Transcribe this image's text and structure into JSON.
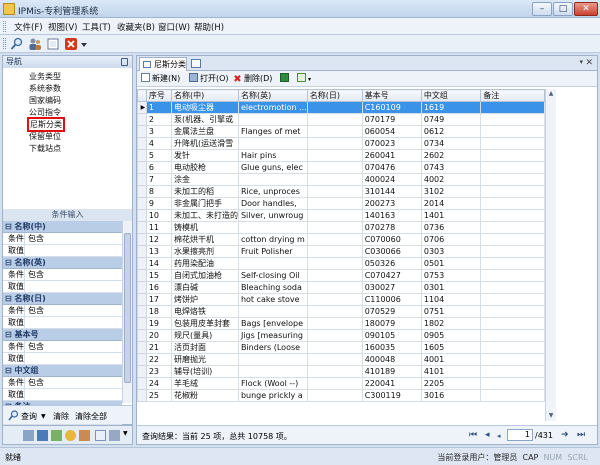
{
  "window": {
    "title": "IPMis-专利管理系统",
    "min": "–",
    "max": "□",
    "close": "✕"
  },
  "menu": [
    "文件(F)",
    "视图(V)",
    "工具(T)",
    "收藏夹(B)",
    "窗口(W)",
    "帮助(H)"
  ],
  "toolbar_icons": [
    "search-icon",
    "users-icon",
    "add-icon",
    "delete-icon",
    "dropdown-icon"
  ],
  "nav": {
    "title": "导航",
    "items": [
      "业务类型",
      "系统参数",
      "国家编码",
      "公司指令",
      "尼斯分类",
      "保留单位",
      "下载站点"
    ],
    "selected": "尼斯分类"
  },
  "conditions": {
    "title": "条件输入",
    "groups": [
      {
        "name": "名称(中)",
        "rows": [
          {
            "k": "条件",
            "v": "包含"
          },
          {
            "k": "取值",
            "v": ""
          }
        ]
      },
      {
        "name": "名称(英)",
        "rows": [
          {
            "k": "条件",
            "v": "包含"
          },
          {
            "k": "取值",
            "v": ""
          }
        ]
      },
      {
        "name": "名称(日)",
        "rows": [
          {
            "k": "条件",
            "v": "包含"
          },
          {
            "k": "取值",
            "v": ""
          }
        ]
      },
      {
        "name": "基本号",
        "rows": [
          {
            "k": "条件",
            "v": "包含"
          },
          {
            "k": "取值",
            "v": ""
          }
        ]
      },
      {
        "name": "中文组",
        "rows": [
          {
            "k": "条件",
            "v": "包含"
          },
          {
            "k": "取值",
            "v": ""
          }
        ]
      },
      {
        "name": "备注",
        "rows": [
          {
            "k": "条件",
            "v": "包含"
          },
          {
            "k": "取值",
            "v": ""
          }
        ]
      }
    ],
    "query_label": "查询",
    "clear_label": "清除",
    "clear_all_label": "清除全部"
  },
  "tab": {
    "label": "尼斯分类"
  },
  "actions": {
    "new": "新建(N)",
    "open": "打开(O)",
    "delete": "删除(D)"
  },
  "table": {
    "columns": [
      "序号",
      "名称(中)",
      "名称(英)",
      "名称(日)",
      "基本号",
      "中文组",
      "备注"
    ],
    "rows": [
      [
        "1",
        "电动吸尘器",
        "electromotion ...",
        "",
        "C160109",
        "1619",
        ""
      ],
      [
        "2",
        "泵(机器、引擎或",
        "",
        "",
        "070179",
        "0749",
        ""
      ],
      [
        "3",
        "金属法兰盘",
        "Flanges of met",
        "",
        "060054",
        "0612",
        ""
      ],
      [
        "4",
        "升降机(运送滑雪",
        "",
        "",
        "070023",
        "0734",
        ""
      ],
      [
        "5",
        "发针",
        "Hair pins",
        "",
        "260041",
        "2602",
        ""
      ],
      [
        "6",
        "电动胶枪",
        "Glue guns, elec",
        "",
        "070476",
        "0743",
        ""
      ],
      [
        "7",
        "涂金",
        "",
        "",
        "400024",
        "4002",
        ""
      ],
      [
        "8",
        "未加工的稻",
        "Rice, unproces",
        "",
        "310144",
        "3102",
        ""
      ],
      [
        "9",
        "非金属门把手",
        "Door handles,",
        "",
        "200273",
        "2014",
        ""
      ],
      [
        "10",
        "未加工、未打造的",
        "Silver, unwroug",
        "",
        "140163",
        "1401",
        ""
      ],
      [
        "11",
        "铸模机",
        "",
        "",
        "070278",
        "0736",
        ""
      ],
      [
        "12",
        "棉花烘干机",
        "cotton drying m",
        "",
        "C070060",
        "0706",
        ""
      ],
      [
        "13",
        "水果擦亮剂",
        "Fruit Polisher",
        "",
        "C030066",
        "0303",
        ""
      ],
      [
        "14",
        "药用染配油",
        "",
        "",
        "050326",
        "0501",
        ""
      ],
      [
        "15",
        "自闭式加油枪",
        "Self-closing Oil",
        "",
        "C070427",
        "0753",
        ""
      ],
      [
        "16",
        "漂白碱",
        "Bleaching soda",
        "",
        "030027",
        "0301",
        ""
      ],
      [
        "17",
        "烤饼炉",
        "hot cake stove",
        "",
        "C110006",
        "1104",
        ""
      ],
      [
        "18",
        "电焊烙铁",
        "",
        "",
        "070529",
        "0751",
        ""
      ],
      [
        "19",
        "包装用皮革封套",
        "Bags [envelope",
        "",
        "180079",
        "1802",
        ""
      ],
      [
        "20",
        "规尺(量具)",
        "Jigs [measuring",
        "",
        "090105",
        "0905",
        ""
      ],
      [
        "21",
        "活页封面",
        "Binders (Loose",
        "",
        "160035",
        "1605",
        ""
      ],
      [
        "22",
        "研磨抛光",
        "",
        "",
        "400048",
        "4001",
        ""
      ],
      [
        "23",
        "辅导(培训)",
        "",
        "",
        "410189",
        "4101",
        ""
      ],
      [
        "24",
        "羊毛绒",
        "Flock (Wool --)",
        "",
        "220041",
        "2205",
        ""
      ],
      [
        "25",
        "花椒粉",
        "bunge prickly a",
        "",
        "C300119",
        "3016",
        ""
      ]
    ]
  },
  "footer": {
    "result": "查询结果：当前 25 项，总共 10758 项。",
    "page": "1",
    "total": "/431"
  },
  "status": {
    "left": "就绪",
    "right": "当前登录用户：管理员",
    "cap": "CAP",
    "num": "NUM",
    "scrl": "SCRL"
  }
}
